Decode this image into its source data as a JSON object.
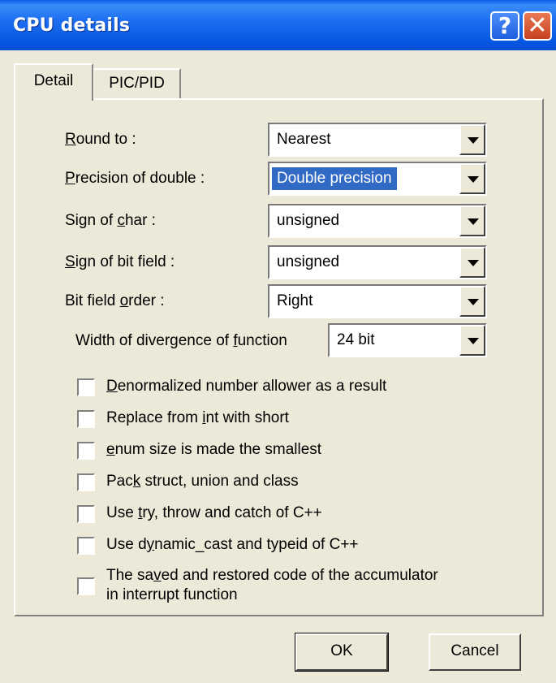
{
  "window": {
    "title": "CPU details"
  },
  "titlebar_buttons": {
    "help": "?",
    "close": "✕"
  },
  "tabs": [
    "Detail",
    "PIC/PID"
  ],
  "fields": [
    {
      "label_pre": "",
      "label_key": "R",
      "label_post": "ound to :",
      "value": "Nearest"
    },
    {
      "label_pre": "",
      "label_key": "P",
      "label_post": "recision of double :",
      "value": "Double precision"
    },
    {
      "label_pre": "Sign of ",
      "label_key": "c",
      "label_post": "har :",
      "value": "unsigned"
    },
    {
      "label_pre": "",
      "label_key": "S",
      "label_post": "ign of bit field :",
      "value": "unsigned"
    },
    {
      "label_pre": "Bit field ",
      "label_key": "o",
      "label_post": "rder :",
      "value": "Right"
    },
    {
      "label_pre": "Width of divergence of ",
      "label_key": "f",
      "label_post": "unction",
      "value": "24 bit"
    }
  ],
  "checkboxes": [
    {
      "pre": "",
      "key": "D",
      "post": "enormalized number allower as a result",
      "checked": false
    },
    {
      "pre": "Replace from ",
      "key": "i",
      "post": "nt with short",
      "checked": false
    },
    {
      "pre": "",
      "key": "e",
      "post": "num size is made the smallest",
      "checked": false
    },
    {
      "pre": "Pac",
      "key": "k",
      "post": " struct, union and class",
      "checked": false
    },
    {
      "pre": "Use ",
      "key": "t",
      "post": "ry, throw and catch of C++",
      "checked": false
    },
    {
      "pre": "Use d",
      "key": "y",
      "post": "namic_cast and typeid of C++",
      "checked": false
    },
    {
      "pre": "The sa",
      "key": "v",
      "post": "ed and restored code of the accumulator",
      "line2": "in interrupt function",
      "checked": false
    }
  ],
  "buttons": {
    "ok": "OK",
    "cancel": "Cancel"
  }
}
